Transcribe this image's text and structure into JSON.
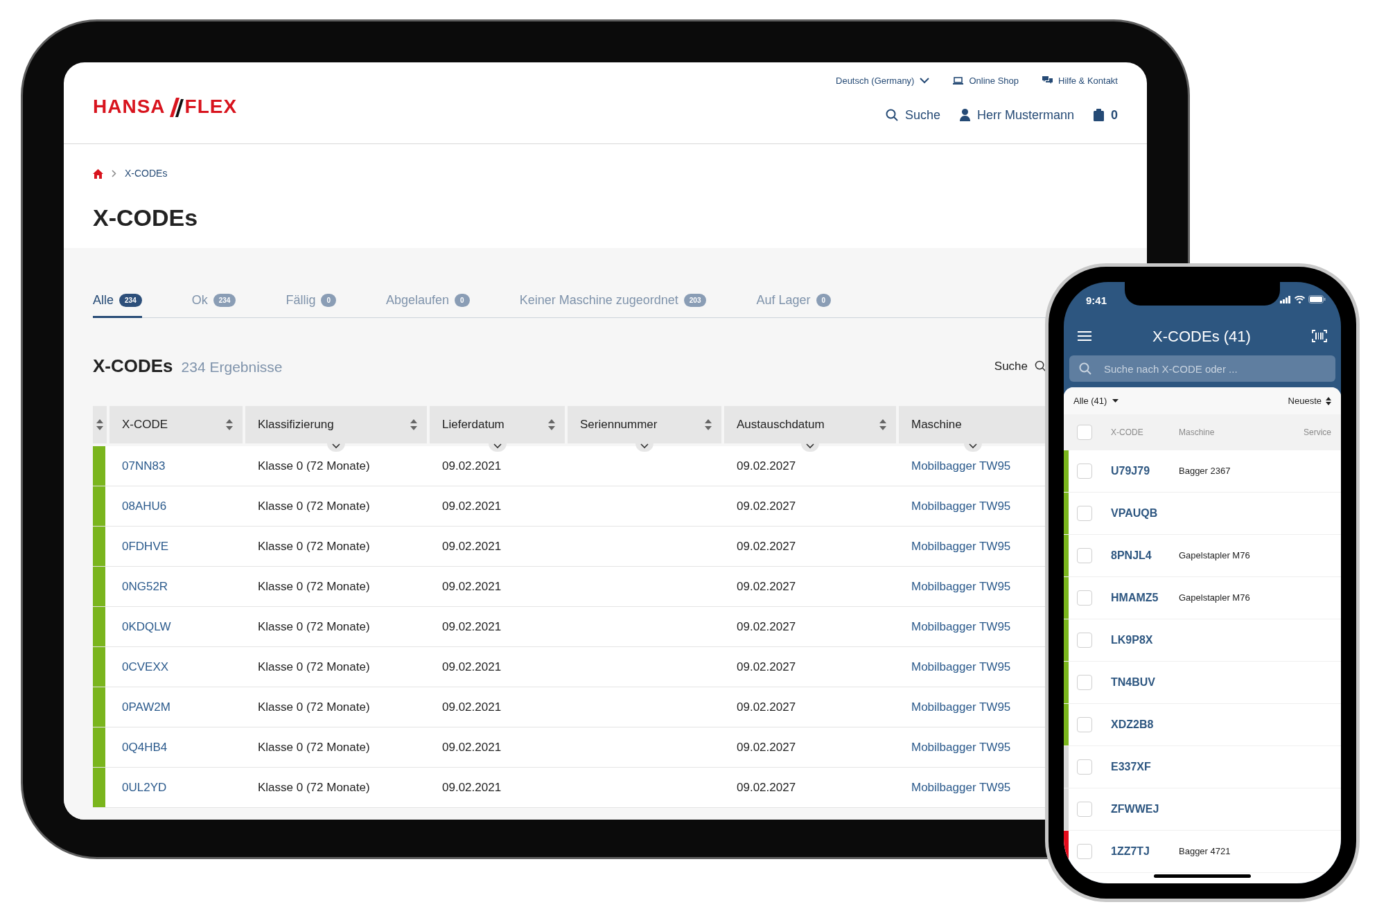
{
  "tablet": {
    "header": {
      "logo": {
        "left": "HANSA",
        "right": "FLEX"
      },
      "top_links": [
        {
          "kind": "language",
          "label": "Deutsch (Germany)"
        },
        {
          "kind": "shop",
          "label": "Online Shop"
        },
        {
          "kind": "help",
          "label": "Hilfe & Kontakt"
        }
      ],
      "nav": [
        {
          "kind": "search",
          "label": "Suche"
        },
        {
          "kind": "user",
          "label": "Herr Mustermann"
        },
        {
          "kind": "cart",
          "label": "0"
        }
      ]
    },
    "breadcrumb": [
      "X-CODEs"
    ],
    "title": "X-CODEs",
    "tabs": [
      {
        "label": "Alle",
        "count": "234",
        "selected": true
      },
      {
        "label": "Ok",
        "count": "234",
        "selected": false
      },
      {
        "label": "Fällig",
        "count": "0",
        "selected": false
      },
      {
        "label": "Abgelaufen",
        "count": "0",
        "selected": false
      },
      {
        "label": "Keiner Maschine zugeordnet",
        "count": "203",
        "selected": false
      },
      {
        "label": "Auf Lager",
        "count": "0",
        "selected": false
      }
    ],
    "results": {
      "title": "X-CODEs",
      "count": "234 Ergebnisse",
      "search_label": "Suche"
    },
    "table": {
      "columns": [
        {
          "label": "X-CODE",
          "sortable": true,
          "filter": false
        },
        {
          "label": "Klassifizierung",
          "sortable": true,
          "filter": true
        },
        {
          "label": "Lieferdatum",
          "sortable": true,
          "filter": true
        },
        {
          "label": "Seriennummer",
          "sortable": true,
          "filter": true
        },
        {
          "label": "Austauschdatum",
          "sortable": true,
          "filter": true
        },
        {
          "label": "Maschine",
          "sortable": false,
          "filter": true
        }
      ],
      "rows": [
        {
          "color": "#7ab51d",
          "x_code": "07NN83",
          "klassifizierung": "Klasse 0 (72 Monate)",
          "lieferdatum": "09.02.2021",
          "austauschdatum": "09.02.2027",
          "maschine": "Mobilbagger TW95"
        },
        {
          "color": "#7ab51d",
          "x_code": "08AHU6",
          "klassifizierung": "Klasse 0 (72 Monate)",
          "lieferdatum": "09.02.2021",
          "austauschdatum": "09.02.2027",
          "maschine": "Mobilbagger TW95"
        },
        {
          "color": "#7ab51d",
          "x_code": "0FDHVE",
          "klassifizierung": "Klasse 0 (72 Monate)",
          "lieferdatum": "09.02.2021",
          "austauschdatum": "09.02.2027",
          "maschine": "Mobilbagger TW95"
        },
        {
          "color": "#7ab51d",
          "x_code": "0NG52R",
          "klassifizierung": "Klasse 0 (72 Monate)",
          "lieferdatum": "09.02.2021",
          "austauschdatum": "09.02.2027",
          "maschine": "Mobilbagger TW95"
        },
        {
          "color": "#7ab51d",
          "x_code": "0KDQLW",
          "klassifizierung": "Klasse 0 (72 Monate)",
          "lieferdatum": "09.02.2021",
          "austauschdatum": "09.02.2027",
          "maschine": "Mobilbagger TW95"
        },
        {
          "color": "#7ab51d",
          "x_code": "0CVEXX",
          "klassifizierung": "Klasse 0 (72 Monate)",
          "lieferdatum": "09.02.2021",
          "austauschdatum": "09.02.2027",
          "maschine": "Mobilbagger TW95"
        },
        {
          "color": "#7ab51d",
          "x_code": "0PAW2M",
          "klassifizierung": "Klasse 0 (72 Monate)",
          "lieferdatum": "09.02.2021",
          "austauschdatum": "09.02.2027",
          "maschine": "Mobilbagger TW95"
        },
        {
          "color": "#7ab51d",
          "x_code": "0Q4HB4",
          "klassifizierung": "Klasse 0 (72 Monate)",
          "lieferdatum": "09.02.2021",
          "austauschdatum": "09.02.2027",
          "maschine": "Mobilbagger TW95"
        },
        {
          "color": "#7ab51d",
          "x_code": "0UL2YD",
          "klassifizierung": "Klasse 0 (72 Monate)",
          "lieferdatum": "09.02.2021",
          "austauschdatum": "09.02.2027",
          "maschine": "Mobilbagger TW95"
        }
      ]
    }
  },
  "phone": {
    "status_bar": {
      "time": "9:41"
    },
    "title": "X-CODEs (41)",
    "search": {
      "placeholder": "Suche nach X-CODE oder ..."
    },
    "filter": {
      "label": "Alle (41)"
    },
    "sort": {
      "label": "Neueste"
    },
    "list": {
      "columns": [
        "X-CODE",
        "Maschine",
        "Service"
      ],
      "select_all_checked": false,
      "rows": [
        {
          "color": "#7ab51d",
          "code": "U79J79",
          "machine": "Bagger 2367",
          "checked": false
        },
        {
          "color": "#7ab51d",
          "code": "VPAUQB",
          "checked": false
        },
        {
          "color": "#7ab51d",
          "code": "8PNJL4",
          "machine": "Gapelstapler M76",
          "checked": false
        },
        {
          "color": "#7ab51d",
          "code": "HMAMZ5",
          "machine": "Gapelstapler M76",
          "checked": false
        },
        {
          "color": "#7ab51d",
          "code": "LK9P8X",
          "checked": false
        },
        {
          "color": "#7ab51d",
          "code": "TN4BUV",
          "checked": false
        },
        {
          "color": "#7ab51d",
          "code": "XDZ2B8",
          "checked": false
        },
        {
          "color": "#d9d9d9",
          "code": "E337XF",
          "checked": false
        },
        {
          "color": "#d9d9d9",
          "code": "ZFWWEJ",
          "checked": false
        },
        {
          "color": "#e30b1c",
          "code": "1ZZ7TJ",
          "machine": "Bagger 4721",
          "checked": false
        }
      ]
    }
  }
}
